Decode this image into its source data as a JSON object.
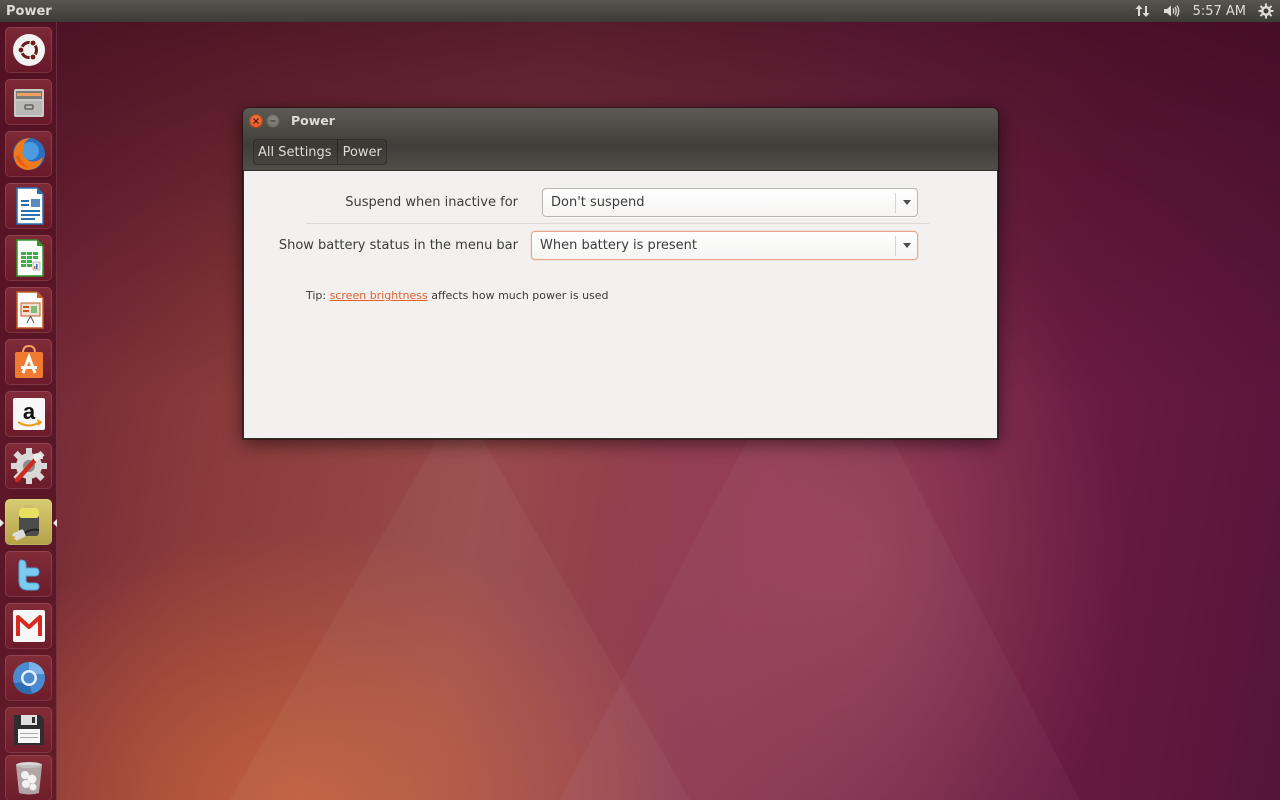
{
  "top_panel": {
    "app_title": "Power",
    "indicators": {
      "network_icon": "network-updown-icon",
      "sound_icon": "volume-icon",
      "clock": "5:57 AM",
      "session_icon": "gear-power-icon"
    }
  },
  "launcher": {
    "items": [
      {
        "name": "Dash Home",
        "icon": "ubuntu-logo-icon",
        "active": false
      },
      {
        "name": "Files",
        "icon": "file-cabinet-icon",
        "active": false
      },
      {
        "name": "Firefox Web Browser",
        "icon": "firefox-icon",
        "active": false
      },
      {
        "name": "LibreOffice Writer",
        "icon": "writer-document-icon",
        "active": false
      },
      {
        "name": "LibreOffice Calc",
        "icon": "calc-spreadsheet-icon",
        "active": false
      },
      {
        "name": "LibreOffice Impress",
        "icon": "impress-presentation-icon",
        "active": false
      },
      {
        "name": "Ubuntu Software Center",
        "icon": "software-center-bag-icon",
        "active": false
      },
      {
        "name": "Amazon",
        "icon": "amazon-icon",
        "active": false
      },
      {
        "name": "System Settings",
        "icon": "settings-wrench-gear-icon",
        "active": false
      },
      {
        "name": "Power",
        "icon": "battery-plug-icon",
        "active": true
      },
      {
        "name": "Twitter",
        "icon": "twitter-icon",
        "active": false
      },
      {
        "name": "Gmail",
        "icon": "gmail-icon",
        "active": false
      },
      {
        "name": "Chromium Web Browser",
        "icon": "chromium-icon",
        "active": false
      },
      {
        "name": "Save / Floppy",
        "icon": "floppy-disk-icon",
        "active": false
      },
      {
        "name": "Trash",
        "icon": "trash-icon",
        "active": false
      }
    ]
  },
  "window": {
    "title": "Power",
    "breadcrumbs": [
      "All Settings",
      "Power"
    ],
    "settings": [
      {
        "label": "Suspend when inactive for",
        "value": "Don't suspend",
        "focused": false
      },
      {
        "label": "Show battery status in the menu bar",
        "value": "When battery is present",
        "focused": true
      }
    ],
    "tip": {
      "prefix": "Tip: ",
      "link": "screen brightness",
      "suffix": " affects how much power is used"
    }
  },
  "colors": {
    "accent": "#e35f2a",
    "panel": "#3c3b37",
    "window_bg": "#f2f1f0",
    "close_button": "#df4a16"
  }
}
